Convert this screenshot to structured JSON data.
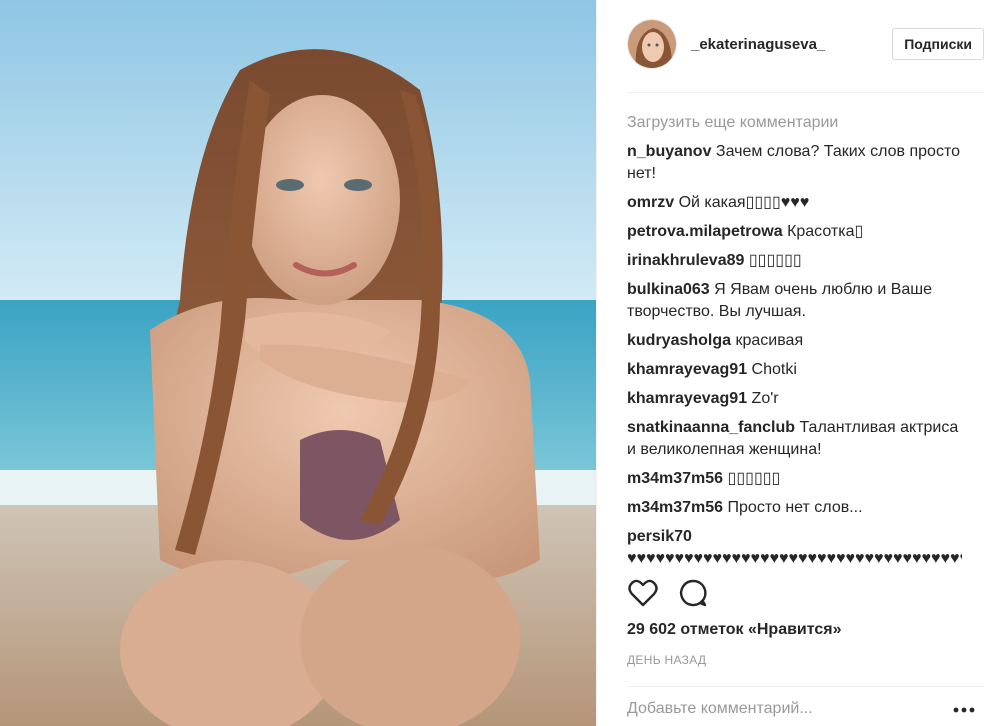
{
  "post": {
    "username": "_ekaterinaguseva_",
    "follow_label": "Подписки",
    "load_more": "Загрузить еще комментарии",
    "comments": [
      {
        "user": "n_buyanov",
        "text": "Зачем слова? Таких слов просто нет!"
      },
      {
        "user": "omrzv",
        "text": "Ой какая▯▯▯▯♥♥♥"
      },
      {
        "user": "petrova.milapetrowa",
        "text": "Красотка▯"
      },
      {
        "user": "irinakhruleva89",
        "text": "▯▯▯▯▯▯"
      },
      {
        "user": "bulkina063",
        "text": "Я Явам очень люблю и Ваше творчество. Вы лучшая."
      },
      {
        "user": "kudryasholga",
        "text": "красивая"
      },
      {
        "user": "khamrayevag91",
        "text": "Chotki"
      },
      {
        "user": "khamrayevag91",
        "text": "Zo'r"
      },
      {
        "user": "snatkinaanna_fanclub",
        "text": "Талантливая актриса и великолепная женщина!"
      },
      {
        "user": "m34m37m56",
        "text": "▯▯▯▯▯▯"
      },
      {
        "user": "m34m37m56",
        "text": "Просто нет слов..."
      },
      {
        "user": "persik70",
        "text": "♥♥♥♥♥♥♥♥♥♥♥♥♥♥♥♥♥♥♥♥♥♥♥♥♥♥♥♥♥♥♥♥♥♥♥♥♥♥"
      }
    ],
    "likes": "29 602 отметок «Нравится»",
    "time": "ДЕНЬ НАЗАД",
    "comment_placeholder": "Добавьте комментарий...",
    "icons": {
      "like": "heart-outline-icon",
      "comment": "speech-bubble-icon",
      "more": "more-dots-icon"
    }
  }
}
